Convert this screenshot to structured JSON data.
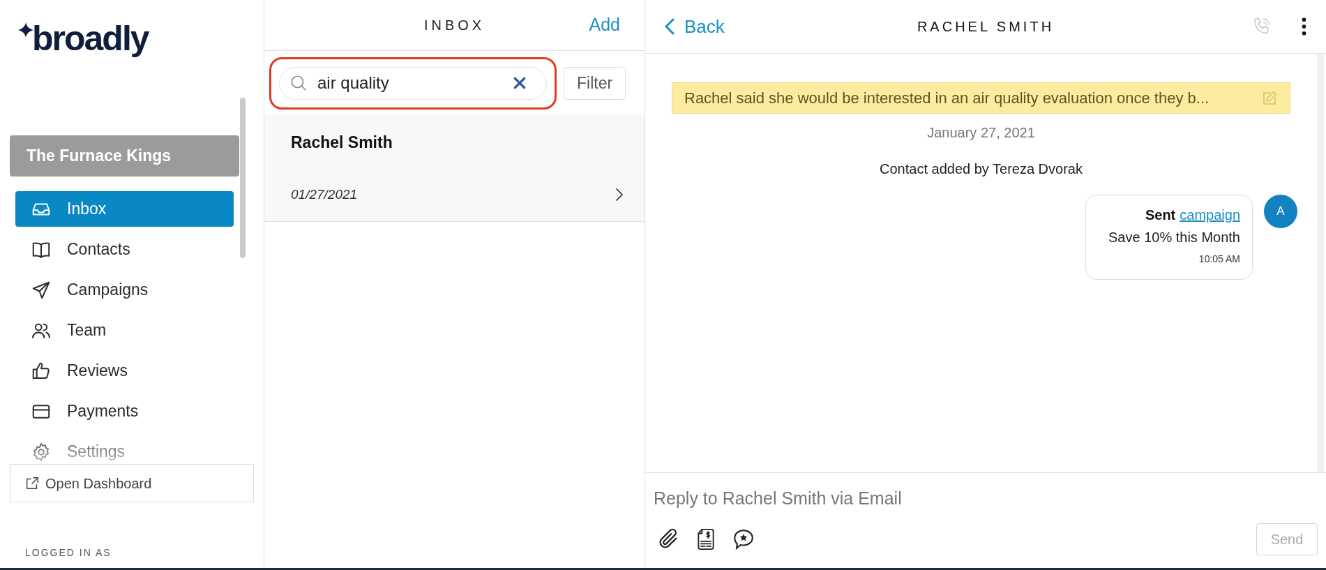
{
  "logo": {
    "text": "broadly"
  },
  "sidebar": {
    "account": "The Furnace Kings",
    "items": [
      {
        "label": "Inbox",
        "selected": true
      },
      {
        "label": "Contacts",
        "selected": false
      },
      {
        "label": "Campaigns",
        "selected": false
      },
      {
        "label": "Team",
        "selected": false
      },
      {
        "label": "Reviews",
        "selected": false
      },
      {
        "label": "Payments",
        "selected": false
      },
      {
        "label": "Settings",
        "selected": false
      }
    ],
    "open_dashboard": "Open Dashboard",
    "logged_in_label": "LOGGED IN AS"
  },
  "inbox": {
    "title": "INBOX",
    "add": "Add",
    "search": {
      "value": "air quality"
    },
    "filter": "Filter",
    "conversations": [
      {
        "name": "Rachel Smith",
        "date": "01/27/2021"
      }
    ]
  },
  "conversation": {
    "back": "Back",
    "title": "RACHEL SMITH",
    "note": "Rachel said she would be interested in an air quality evaluation once they b...",
    "date": "January 27, 2021",
    "events": [
      {
        "kind": "system",
        "text": "Contact added by Tereza Dvorak"
      },
      {
        "kind": "sent",
        "label": "Sent",
        "link": "campaign",
        "body": "Save 10% this Month",
        "time": "10:05 AM",
        "avatar": "A"
      }
    ],
    "composer": {
      "placeholder": "Reply to Rachel Smith via Email",
      "send": "Send",
      "send_disabled": true
    }
  }
}
